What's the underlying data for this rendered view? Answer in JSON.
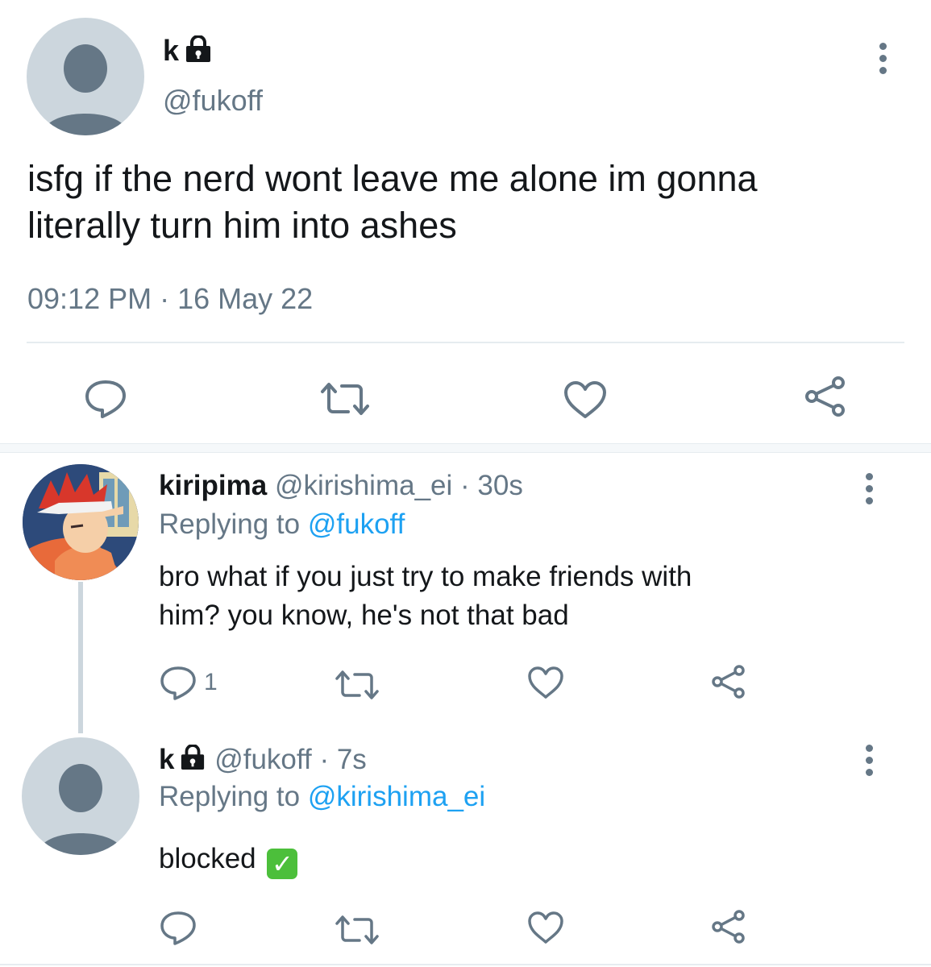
{
  "main_tweet": {
    "name": "k",
    "handle": "@fukoff",
    "text_line1": "isfg if the nerd wont leave me alone im gonna",
    "text_line2": "literally turn him into ashes",
    "timestamp": "09:12 PM · 16 May 22",
    "icons": [
      "reply-icon",
      "retweet-icon",
      "like-icon",
      "share-icon"
    ]
  },
  "reply1": {
    "name": "kiripima",
    "handle": "@kirishima_ei",
    "time": "· 30s",
    "replying_prefix": "Replying to",
    "replying_to": "@fukoff",
    "text_line1": "bro what if you just try to make friends with",
    "text_line2": "him? you know, he's not that bad",
    "reply_count": "1"
  },
  "reply2": {
    "name": "k",
    "handle": "@fukoff",
    "time": "· 7s",
    "replying_prefix": "Replying to",
    "replying_to": "@kirishima_ei",
    "text": "blocked",
    "emoji": "✓"
  },
  "colors": {
    "text": "#14171a",
    "secondary": "#657786",
    "link": "#1da1f2",
    "avatar_bg": "#ccd6dd",
    "check_green": "#4cbf3b"
  }
}
